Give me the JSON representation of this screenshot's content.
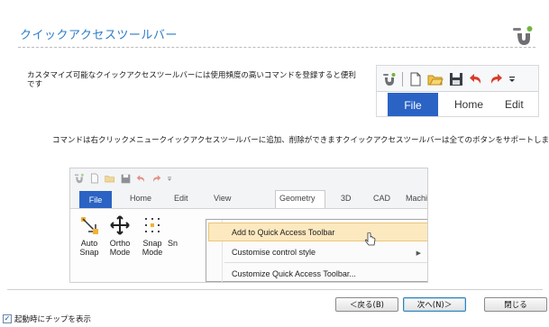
{
  "page": {
    "title": "クイックアクセスツールバー",
    "description_1": "カスタマイズ可能なクイックアクセスツールバーには使用頻度の高いコマンドを登録すると便利です",
    "description_2": "コマンドは右クリックメニュークイックアクセスツールバーに追加、削除ができますクイックアクセスツールバーは全てのボタンをサポートします"
  },
  "inset_1": {
    "tabs": [
      "File",
      "Home",
      "Edit"
    ],
    "accent": "#2b63c4"
  },
  "inset_2": {
    "tabs": [
      "File",
      "Home",
      "Edit",
      "View",
      "Geometry",
      "3D",
      "CAD",
      "Machine"
    ],
    "tools": [
      {
        "label": "Auto\nSnap",
        "icon": "auto-snap-icon"
      },
      {
        "label": "Ortho\nMode",
        "icon": "ortho-mode-icon"
      },
      {
        "label": "Snap\nMode",
        "icon": "snap-mode-icon"
      }
    ],
    "tool_partial": "Sn",
    "context_menu": {
      "items": [
        "Add to Quick Access Toolbar",
        "Customise control style",
        "Customize Quick Access Toolbar..."
      ],
      "highlight_color": "#fde9bf"
    }
  },
  "footer": {
    "back_label": "＜戻る(B)",
    "next_label": "次へ(N)＞",
    "close_label": "閉じる",
    "show_tips_label": "起動時にチップを表示",
    "show_tips_checked": true
  }
}
